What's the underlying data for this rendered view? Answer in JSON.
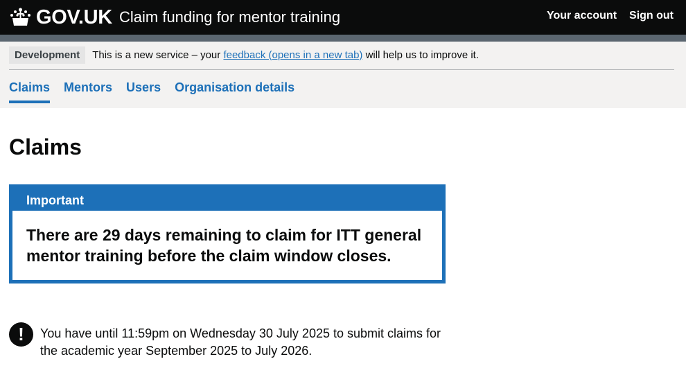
{
  "header": {
    "logo_text": "GOV.UK",
    "service_name": "Claim funding for mentor training",
    "nav": [
      "Your account",
      "Sign out"
    ]
  },
  "phase_banner": {
    "tag": "Development",
    "text_before": "This is a new service – your",
    "link_text": "feedback (opens in a new tab)",
    "text_after": "will help us to improve it."
  },
  "primary_nav": {
    "items": [
      "Claims",
      "Mentors",
      "Users",
      "Organisation details"
    ],
    "active": "Claims"
  },
  "page_title": "Claims",
  "notification": {
    "title": "Important",
    "heading": "There are 29 days remaining to claim for ITT general mentor training before the claim window closes."
  },
  "warning": {
    "icon": "!",
    "text": "You have until 11:59pm on Wednesday 30 July 2025 to submit claims for the academic year September 2025 to July 2026."
  },
  "colors": {
    "header_bg": "#0b0c0c",
    "link": "#1d70b8",
    "banner_bg": "#f3f2f1"
  }
}
